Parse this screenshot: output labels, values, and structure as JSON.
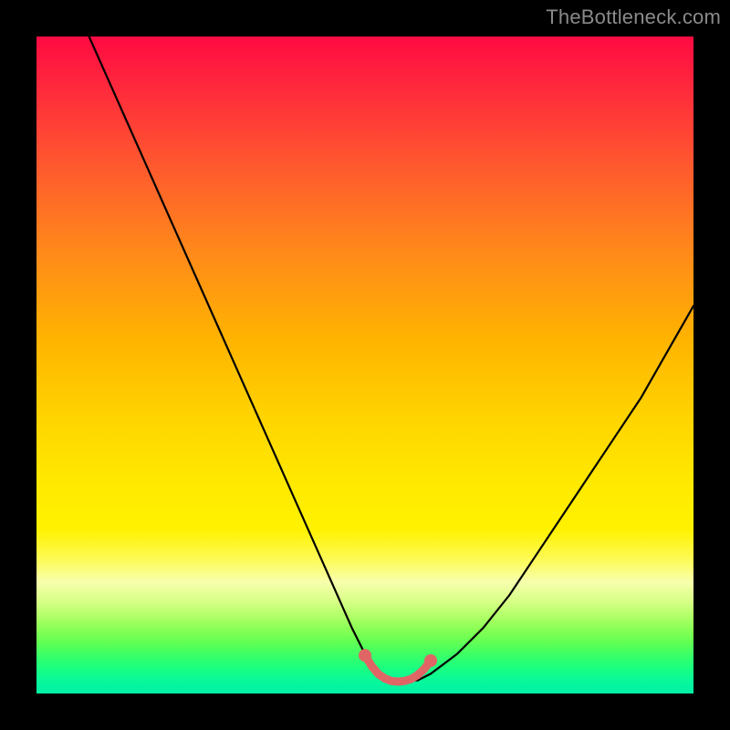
{
  "watermark": "TheBottleneck.com",
  "chart_data": {
    "type": "line",
    "title": "",
    "xlabel": "",
    "ylabel": "",
    "xlim": [
      0,
      100
    ],
    "ylim": [
      0,
      100
    ],
    "grid": false,
    "legend": false,
    "series": [
      {
        "name": "bottleneck-curve",
        "x": [
          8,
          12,
          16,
          20,
          24,
          28,
          32,
          36,
          40,
          44,
          48,
          50,
          52,
          54,
          56,
          58,
          60,
          64,
          68,
          72,
          76,
          80,
          84,
          88,
          92,
          96,
          100
        ],
        "values": [
          100,
          91,
          82,
          73,
          64,
          55,
          46,
          37,
          28,
          19,
          10,
          6,
          3,
          2,
          2,
          2,
          3,
          6,
          10,
          15,
          21,
          27,
          33,
          39,
          45,
          52,
          59
        ]
      },
      {
        "name": "highlight-segment",
        "x": [
          50,
          51,
          52,
          53,
          54,
          55,
          56,
          57,
          58,
          59,
          60
        ],
        "values": [
          5.8,
          4.2,
          3.0,
          2.3,
          1.9,
          1.8,
          1.9,
          2.2,
          2.8,
          3.7,
          5.0
        ]
      }
    ],
    "gradient_stops": [
      {
        "pos": 0.0,
        "color": "#ff0a42"
      },
      {
        "pos": 0.5,
        "color": "#ffd400"
      },
      {
        "pos": 0.83,
        "color": "#f7ffad"
      },
      {
        "pos": 1.0,
        "color": "#00f2a6"
      }
    ],
    "highlight_color": "#e06666"
  }
}
